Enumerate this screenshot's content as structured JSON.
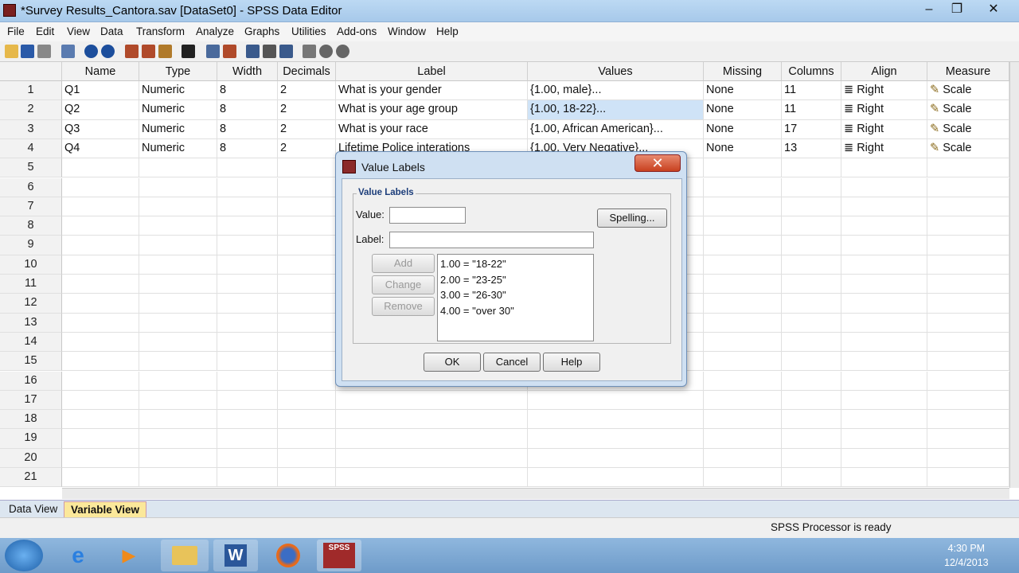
{
  "window": {
    "title": "*Survey Results_Cantora.sav [DataSet0] - SPSS Data Editor",
    "minimize": "–",
    "maximize": "❐",
    "close": "✕"
  },
  "menu": [
    "File",
    "Edit",
    "View",
    "Data",
    "Transform",
    "Analyze",
    "Graphs",
    "Utilities",
    "Add-ons",
    "Window",
    "Help"
  ],
  "toolbar_icons": [
    "open-icon",
    "save-icon",
    "print-icon",
    "dialog-recall-icon",
    "undo-icon",
    "redo-icon",
    "goto-case-icon",
    "goto-variable-icon",
    "variables-icon",
    "find-icon",
    "insert-cases-icon",
    "insert-variable-icon",
    "split-file-icon",
    "weight-cases-icon",
    "select-cases-icon",
    "value-labels-icon",
    "use-sets-icon",
    "show-all-icon"
  ],
  "grid": {
    "headers": [
      "Name",
      "Type",
      "Width",
      "Decimals",
      "Label",
      "Values",
      "Missing",
      "Columns",
      "Align",
      "Measure"
    ],
    "rows": [
      {
        "n": "1",
        "name": "Q1",
        "type": "Numeric",
        "width": "8",
        "decimals": "2",
        "label": "What is your gender",
        "values": "{1.00, male}...",
        "missing": "None",
        "columns": "11",
        "align": "Right",
        "measure": "Scale"
      },
      {
        "n": "2",
        "name": "Q2",
        "type": "Numeric",
        "width": "8",
        "decimals": "2",
        "label": "What is your age group",
        "values": "{1.00, 18-22}...",
        "missing": "None",
        "columns": "11",
        "align": "Right",
        "measure": "Scale"
      },
      {
        "n": "3",
        "name": "Q3",
        "type": "Numeric",
        "width": "8",
        "decimals": "2",
        "label": "What is your race",
        "values": "{1.00, African American}...",
        "missing": "None",
        "columns": "17",
        "align": "Right",
        "measure": "Scale"
      },
      {
        "n": "4",
        "name": "Q4",
        "type": "Numeric",
        "width": "8",
        "decimals": "2",
        "label": "Lifetime Police interations",
        "values": "{1.00, Very Negative}...",
        "missing": "None",
        "columns": "13",
        "align": "Right",
        "measure": "Scale"
      }
    ],
    "empty_rows": [
      "5",
      "6",
      "7",
      "8",
      "9",
      "10",
      "11",
      "12",
      "13",
      "14",
      "15",
      "16",
      "17",
      "18",
      "19",
      "20",
      "21"
    ]
  },
  "tabs": {
    "data_view": "Data View",
    "variable_view": "Variable View"
  },
  "status": "SPSS  Processor is ready",
  "dialog": {
    "title": "Value Labels",
    "group_title": "Value Labels",
    "value_label": "Value:",
    "label_label": "Label:",
    "spelling": "Spelling...",
    "add": "Add",
    "change": "Change",
    "remove": "Remove",
    "items": [
      "1.00 = \"18-22\"",
      "2.00 = \"23-25\"",
      "3.00 = \"26-30\"",
      "4.00 = \"over 30\""
    ],
    "ok": "OK",
    "cancel": "Cancel",
    "help": "Help",
    "close": "✕"
  },
  "taskbar": {
    "apps": [
      "start-orb",
      "ie-icon",
      "media-player-icon",
      "explorer-icon",
      "word-icon",
      "firefox-icon",
      "spss-icon"
    ],
    "spss_text": "SPSS",
    "time": "4:30 PM",
    "date": "12/4/2013"
  }
}
